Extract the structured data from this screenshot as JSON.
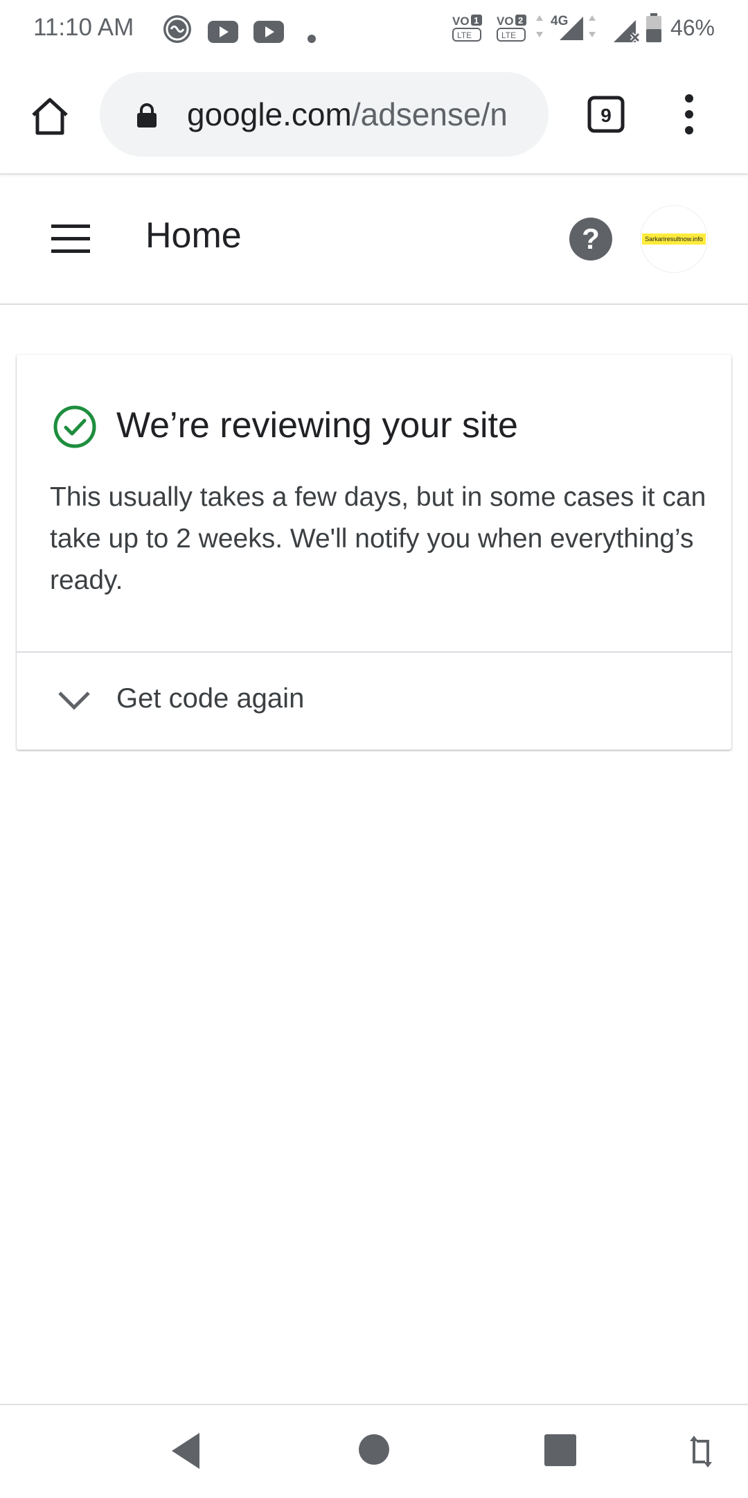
{
  "status_bar": {
    "time": "11:10 AM",
    "battery": "46%",
    "icons": [
      "lite-app-icon",
      "youtube-icon",
      "youtube-icon",
      "dot-icon",
      "volte1-icon",
      "volte2-icon",
      "4g-signal-icon",
      "no-signal-icon",
      "battery-icon"
    ],
    "volte1": "VO",
    "volte2": "VO",
    "network": "4G"
  },
  "browser": {
    "url_domain": "google.com",
    "url_path": "/adsense/n",
    "tab_count": "9"
  },
  "header": {
    "title": "Home",
    "avatar_text": "Sarkariresultnow.info"
  },
  "card": {
    "title": "We’re reviewing your site",
    "body": "This usually takes a few days, but in some cases it can take up to 2 weeks. We'll notify you when everything’s ready.",
    "expand_label": "Get code again"
  },
  "colors": {
    "success": "#1e8e3e",
    "icon_dark": "#5f6368",
    "url_bg": "#f1f3f4",
    "avatar_highlight": "#ffeb3b"
  }
}
